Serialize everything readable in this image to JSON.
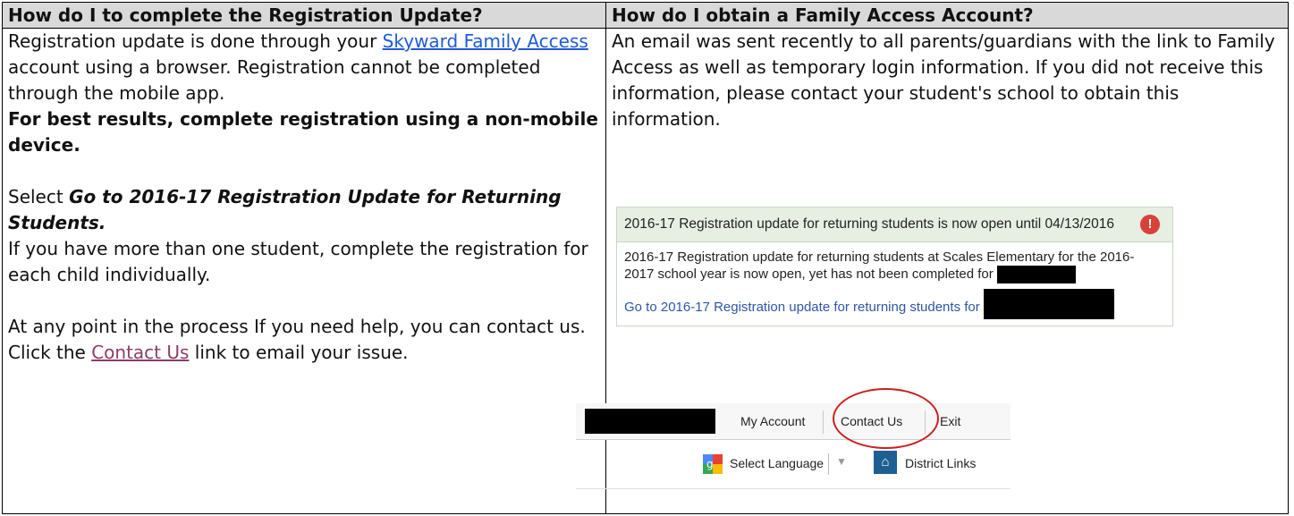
{
  "headers": {
    "left": "How do I to complete the Registration Update?",
    "right": "How do I obtain a Family Access Account?"
  },
  "left_col": {
    "p1_before": "Registration update is done through your ",
    "p1_link": "Skyward Family Access",
    "p1_after": " account using a browser. Registration cannot be completed through the mobile app.",
    "p2_bold": "For best results, complete registration using a non-mobile device.",
    "p3_prefix": "Select ",
    "p3_bold_italic": "Go to 2016-17 Registration Update for Returning Students.",
    "p4": "If you have more than one student, complete the registration for each child individually.",
    "p5_before": "At any point in the process If you need help, you can contact us.  Click the ",
    "p5_link": "Contact Us",
    "p5_after": " link to email your issue."
  },
  "right_col": {
    "p1": "An email was sent recently to all parents/guardians with the link to Family Access as well as temporary login information.  If you did not receive this information, please contact your student's school to obtain this information."
  },
  "notice": {
    "title": "2016-17 Registration update for returning students is now open until 04/13/2016",
    "alert_icon": "!",
    "body_line1": "2016-17 Registration update for returning students at Scales Elementary for the 2016-",
    "body_line2": "2017 school year is now open, yet has not been completed for",
    "link": "Go to 2016-17 Registration update for returning students for"
  },
  "toolbar": {
    "my_account": "My Account",
    "contact_us": "Contact Us",
    "exit": "Exit",
    "select_language": "Select Language",
    "dropdown_arrow": "▼",
    "district_links": "District Links"
  }
}
